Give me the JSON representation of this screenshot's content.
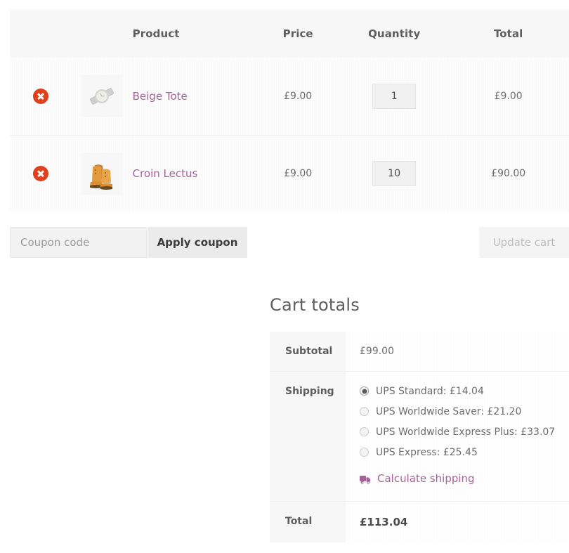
{
  "cart_table": {
    "columns": [
      {
        "key": "remove",
        "label": ""
      },
      {
        "key": "thumb",
        "label": ""
      },
      {
        "key": "name",
        "label": "Product"
      },
      {
        "key": "price",
        "label": "Price"
      },
      {
        "key": "quantity",
        "label": "Quantity"
      },
      {
        "key": "total",
        "label": "Total"
      }
    ],
    "rows": [
      {
        "remove_icon": "remove-circle-icon",
        "thumb_icon": "product-thumbnail-watch",
        "name": "Beige Tote",
        "price": "£9.00",
        "quantity": "1",
        "total": "£9.00"
      },
      {
        "remove_icon": "remove-circle-icon",
        "thumb_icon": "product-thumbnail-boots",
        "name": "Croin Lectus",
        "price": "£9.00",
        "quantity": "10",
        "total": "£90.00"
      }
    ]
  },
  "actions": {
    "coupon_placeholder": "Coupon code",
    "coupon_value": "",
    "apply_coupon_label": "Apply coupon",
    "update_cart_label": "Update cart"
  },
  "totals": {
    "title": "Cart totals",
    "subtotal_label": "Subtotal",
    "subtotal_value": "£99.00",
    "shipping_label": "Shipping",
    "shipping_options": [
      {
        "label": "UPS Standard: £14.04",
        "selected": true
      },
      {
        "label": "UPS Worldwide Saver: £21.20",
        "selected": false
      },
      {
        "label": "UPS Worldwide Express Plus: £33.07",
        "selected": false
      },
      {
        "label": "UPS Express: £25.45",
        "selected": false
      }
    ],
    "calculate_shipping_label": "Calculate shipping",
    "calculate_shipping_icon": "truck-icon",
    "total_label": "Total",
    "total_value": "£113.04"
  },
  "colors": {
    "link": "#a46497",
    "remove_badge": "#e2401c",
    "header_bg": "#f7f7f7",
    "row_bg": "#fcfcfc",
    "text": "#6d6d6d",
    "button_bg": "#ebebeb",
    "disabled_text": "#bcbcbc"
  }
}
